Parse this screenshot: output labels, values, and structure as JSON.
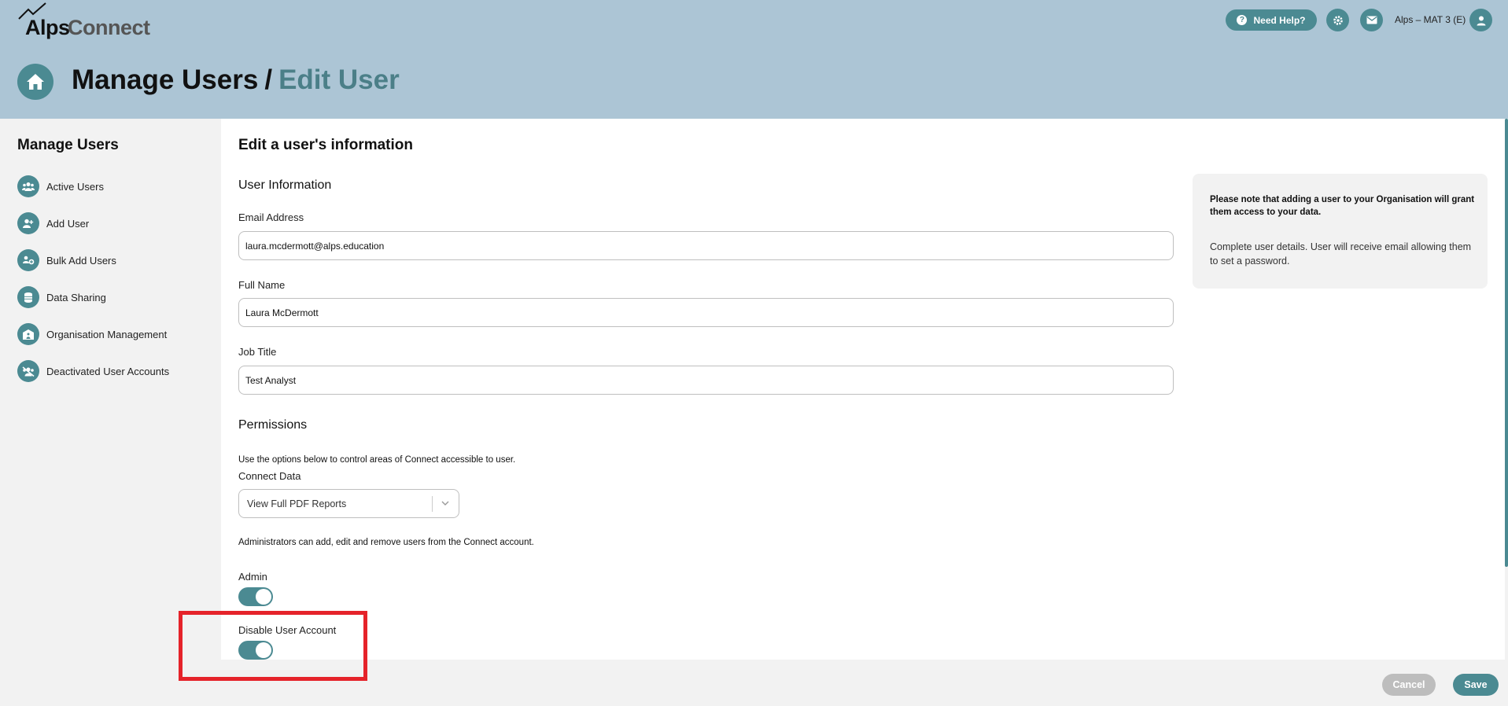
{
  "brand": {
    "alps": "Alps",
    "connect": "Connect"
  },
  "header": {
    "help_label": "Need Help?",
    "account_name": "Alps – MAT 3 (E)",
    "title_main": "Manage Users",
    "title_separator": "/",
    "title_sub": "Edit User"
  },
  "sidebar": {
    "title": "Manage Users",
    "items": [
      {
        "label": "Active Users",
        "icon": "users-icon"
      },
      {
        "label": "Add User",
        "icon": "add-user-icon"
      },
      {
        "label": "Bulk Add Users",
        "icon": "bulk-users-icon"
      },
      {
        "label": "Data Sharing",
        "icon": "database-icon"
      },
      {
        "label": "Organisation Management",
        "icon": "organisation-icon"
      },
      {
        "label": "Deactivated User Accounts",
        "icon": "deactivated-users-icon"
      }
    ]
  },
  "main": {
    "heading": "Edit a user's information",
    "user_info": {
      "title": "User Information",
      "email_label": "Email Address",
      "email_value": "laura.mcdermott@alps.education",
      "name_label": "Full Name",
      "name_value": "Laura McDermott",
      "job_label": "Job Title",
      "job_value": "Test Analyst"
    },
    "permissions": {
      "title": "Permissions",
      "hint": "Use the options below to control areas of Connect accessible to user.",
      "connect_data_label": "Connect Data",
      "connect_data_value": "View Full PDF Reports",
      "admin_hint": "Administrators can add, edit and remove users from the Connect account.",
      "admin_label": "Admin",
      "admin_on": true,
      "disable_label": "Disable User Account",
      "disable_on": true
    },
    "info_box": {
      "note": "Please note that adding a user to your Organisation will grant them access to your data.",
      "detail": "Complete user details. User will receive email allowing them to set a password."
    }
  },
  "footer": {
    "cancel_label": "Cancel",
    "save_label": "Save"
  },
  "colors": {
    "header_bg": "#acc5d5",
    "accent": "#4b8a92",
    "highlight": "#e5232a"
  }
}
